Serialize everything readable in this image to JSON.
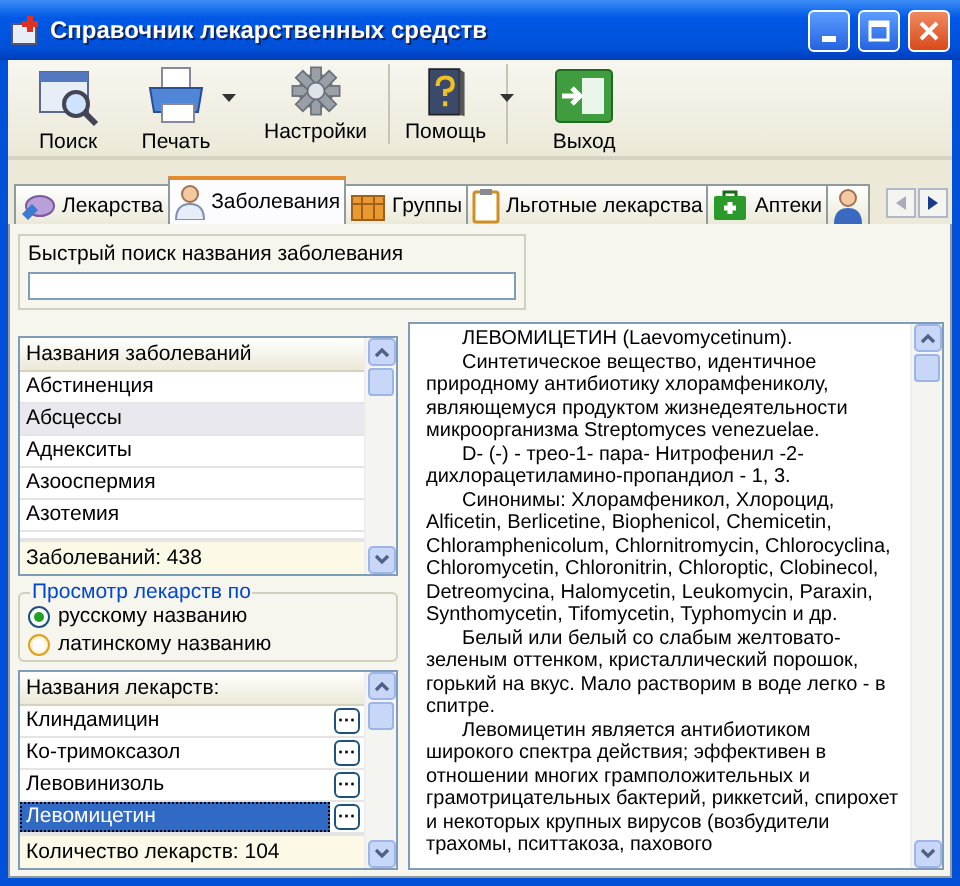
{
  "window": {
    "title": "Справочник лекарственных средств"
  },
  "toolbar": [
    {
      "label": "Поиск",
      "dropdown": false,
      "separator_after": false
    },
    {
      "label": "Печать",
      "dropdown": true,
      "separator_after": false
    },
    {
      "label": "Настройки",
      "dropdown": false,
      "separator_after": true
    },
    {
      "label": "Помощь",
      "dropdown": true,
      "separator_after": true
    },
    {
      "label": "Выход",
      "dropdown": false,
      "separator_after": false
    }
  ],
  "tabs": [
    {
      "label": "Лекарства",
      "selected": false
    },
    {
      "label": "Заболевания",
      "selected": true
    },
    {
      "label": "Группы",
      "selected": false
    },
    {
      "label": "Льготные лекарства",
      "selected": false
    },
    {
      "label": "Аптеки",
      "selected": false
    },
    {
      "selected": false
    }
  ],
  "disease_search": {
    "label": "Быстрый поиск названия заболевания"
  },
  "diseases": {
    "header": "Названия заболеваний",
    "items": [
      {
        "name": "Абстиненция",
        "selected": false
      },
      {
        "name": "Абсцессы",
        "selected": true
      },
      {
        "name": "Аднекситы",
        "selected": false
      },
      {
        "name": "Азооспермия",
        "selected": false
      },
      {
        "name": "Азотемия",
        "selected": false
      }
    ],
    "footer": "Заболеваний: 438"
  },
  "view_by": {
    "title": "Просмотр лекарств по",
    "options": [
      {
        "label": "русскому названию",
        "selected": true
      },
      {
        "label": "латинскому названию",
        "selected": false
      }
    ]
  },
  "drugs": {
    "header": "Названия лекарств:",
    "items": [
      {
        "name": "Клиндамицин",
        "selected": false
      },
      {
        "name": "Ко-тримоксазол",
        "selected": false
      },
      {
        "name": "Левовинизоль",
        "selected": false
      },
      {
        "name": "Левомицетин",
        "selected": true
      }
    ],
    "footer": "Количество лекарств: 104",
    "more_button": "···"
  },
  "description": {
    "paragraphs": [
      "ЛЕВОМИЦЕТИН (Laevomycetinum).",
      "Синтетическое вещество, идентичное природному антибиотику хлорамфениколу, являющемуся продуктом жизнедеятельности микроорганизма Streptomyces venezuelae.",
      "D- (-) - трео-1- пара- Нитрофенил -2-дихлорацетиламино-пропандиол - 1, 3.",
      "Синонимы: Хлорамфеникол, Хлороцид, Alficetin, Berlicetine, Biophenicol, Chemicetin, Chloramphenicolum, Chlornitromycin, Chlorocyclina, Chloromycetin, Chloronitrin, Chloroptic, Clobinecol, Detreomycina, Halomycetin, Leukomycin, Paraxin, Synthomycetin, Tifomycetin, Typhomycin и др.",
      "Белый или белый со слабым желтовато-зеленым оттенком, кристаллический порошок, горький на вкус. Мало растворим в воде легко - в спитре.",
      "Левомицетин является антибиотиком широкого спектра действия; эффективен в отношении многих грамположительных и грамотрицательных бактерий, риккетсий, спирохет и некоторых крупных вирусов (возбудители трахомы, пситтакоза, пахового"
    ]
  }
}
